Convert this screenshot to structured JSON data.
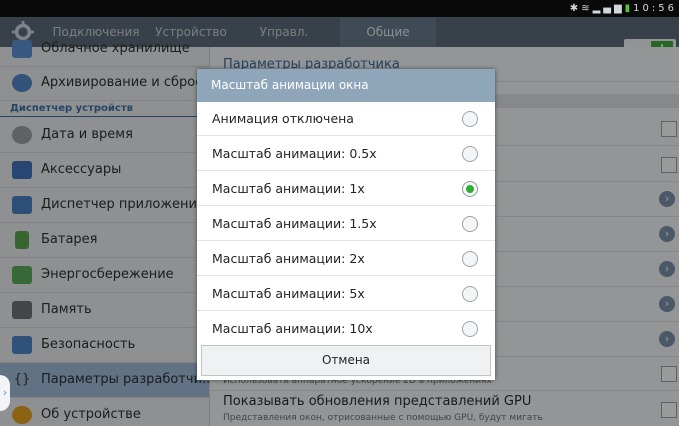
{
  "status_bar": {
    "time": "10:56",
    "icons": [
      "bluetooth-icon",
      "wifi-icon",
      "signal-icon",
      "battery-icon"
    ]
  },
  "tabs": [
    {
      "label": "Подключения",
      "active": false
    },
    {
      "label": "Устройство",
      "active": false
    },
    {
      "label": "Управл.",
      "active": false
    },
    {
      "label": "Общие",
      "active": true
    }
  ],
  "sidebar": {
    "items_top": [
      {
        "label": "Облачное хранилище",
        "icon": "cloud-icon",
        "color": "#5b8fd1"
      },
      {
        "label": "Архивирование и сброс",
        "icon": "backup-icon",
        "color": "#4f86c6"
      }
    ],
    "section_header": "Диспетчер устройств",
    "items": [
      {
        "label": "Дата и время",
        "icon": "clock-icon",
        "color": "#8c8f93"
      },
      {
        "label": "Аксессуары",
        "icon": "accessory-icon",
        "color": "#3f72b8"
      },
      {
        "label": "Диспетчер приложений",
        "icon": "apps-icon",
        "color": "#4a7fc1"
      },
      {
        "label": "Батарея",
        "icon": "battery-icon",
        "color": "#58a34a"
      },
      {
        "label": "Энергосбережение",
        "icon": "power-saving-icon",
        "color": "#5aa85a"
      },
      {
        "label": "Память",
        "icon": "memory-icon",
        "color": "#6d7074"
      },
      {
        "label": "Безопасность",
        "icon": "lock-icon",
        "color": "#4d83c5"
      },
      {
        "label": "Параметры разработчи...",
        "icon": "developer-icon",
        "color": "#333333",
        "selected": true
      },
      {
        "label": "Об устройстве",
        "icon": "info-icon",
        "color": "#e0a020"
      }
    ]
  },
  "right": {
    "header_title": "Параметры разработчика",
    "hw_subtitle": "Использовать аппаратное ускорение 2D в приложениях",
    "gpu_title": "Показывать обновления представлений GPU",
    "gpu_subtitle": "Представления окон, отрисованные с помощью GPU, будут мигать"
  },
  "dialog": {
    "title": "Масштаб анимации окна",
    "options": [
      {
        "label": "Анимация отключена",
        "selected": false
      },
      {
        "label": "Масштаб анимации: 0.5x",
        "selected": false
      },
      {
        "label": "Масштаб анимации: 1x",
        "selected": true
      },
      {
        "label": "Масштаб анимации: 1.5x",
        "selected": false
      },
      {
        "label": "Масштаб анимации: 2x",
        "selected": false
      },
      {
        "label": "Масштаб анимации: 5x",
        "selected": false
      },
      {
        "label": "Масштаб анимации: 10x",
        "selected": false
      }
    ],
    "cancel_label": "Отмена"
  },
  "colors": {
    "accent_green": "#2fae31",
    "dialog_header": "#8fa5ba",
    "tabbar": "#5b6977",
    "selection": "#9db8d6"
  }
}
